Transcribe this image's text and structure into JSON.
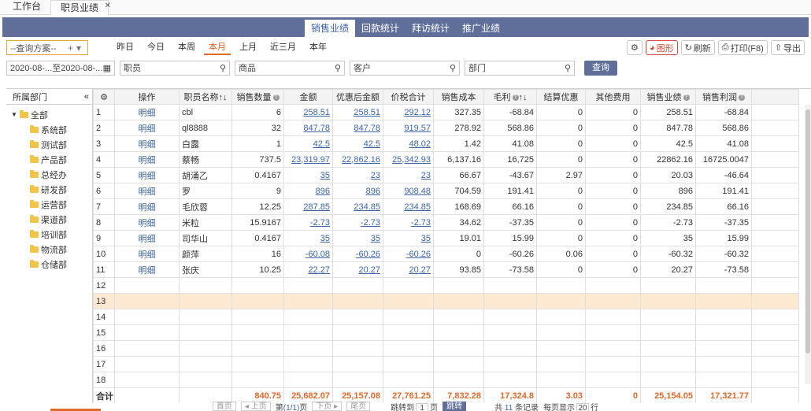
{
  "tabs": [
    {
      "label": "工作台",
      "active": false
    },
    {
      "label": "职员业绩",
      "active": true
    }
  ],
  "header_tabs": [
    {
      "label": "销售业绩",
      "active": true
    },
    {
      "label": "回款统计",
      "active": false
    },
    {
      "label": "拜访统计",
      "active": false
    },
    {
      "label": "推广业绩",
      "active": false
    }
  ],
  "toolbar": {
    "scheme": "--查询方案--",
    "dates": [
      {
        "label": "昨日"
      },
      {
        "label": "今日"
      },
      {
        "label": "本周"
      },
      {
        "label": "本月",
        "active": true
      },
      {
        "label": "上月"
      },
      {
        "label": "近三月"
      },
      {
        "label": "本年"
      }
    ],
    "buttons": {
      "chart": "图形",
      "refresh": "刷新",
      "print": "打印(F8)",
      "export": "导出"
    }
  },
  "filters": {
    "date_range": "2020-08-...至2020-08-...",
    "employee": "职员",
    "product": "商品",
    "customer": "客户",
    "department": "部门",
    "query": "查询"
  },
  "sidebar": {
    "title": "所属部门",
    "root": "全部",
    "items": [
      "系统部",
      "测试部",
      "产品部",
      "总经办",
      "研发部",
      "运营部",
      "渠道部",
      "培训部",
      "物流部",
      "仓储部"
    ]
  },
  "columns": [
    "操作",
    "职员名称",
    "销售数量",
    "金额",
    "优惠后金额",
    "价税合计",
    "销售成本",
    "毛利",
    "结算优惠",
    "其他费用",
    "销售业绩",
    "销售利润"
  ],
  "rows": [
    {
      "n": "1",
      "op": "明细",
      "name": "cbl",
      "qty": "6",
      "amt": "258.51",
      "disc": "258.51",
      "tax": "292.12",
      "cost": "327.35",
      "gross": "-68.84",
      "settle": "0",
      "other": "0",
      "perf": "258.51",
      "profit": "-68.84"
    },
    {
      "n": "2",
      "op": "明细",
      "name": "ql8888",
      "qty": "32",
      "amt": "847.78",
      "disc": "847.78",
      "tax": "919.57",
      "cost": "278.92",
      "gross": "568.86",
      "settle": "0",
      "other": "0",
      "perf": "847.78",
      "profit": "568.86"
    },
    {
      "n": "3",
      "op": "明细",
      "name": "白露",
      "qty": "1",
      "amt": "42.5",
      "disc": "42.5",
      "tax": "48.02",
      "cost": "1.42",
      "gross": "41.08",
      "settle": "0",
      "other": "0",
      "perf": "42.5",
      "profit": "41.08"
    },
    {
      "n": "4",
      "op": "明细",
      "name": "蔡畅",
      "qty": "737.5",
      "amt": "23,319.97",
      "disc": "22,862.16",
      "tax": "25,342.93",
      "cost": "6,137.16",
      "gross": "16,725",
      "settle": "0",
      "other": "0",
      "perf": "22862.16",
      "profit": "16725.0047"
    },
    {
      "n": "5",
      "op": "明细",
      "name": "胡涌乙",
      "qty": "0.4167",
      "amt": "35",
      "disc": "23",
      "tax": "23",
      "cost": "66.67",
      "gross": "-43.67",
      "settle": "2.97",
      "other": "0",
      "perf": "20.03",
      "profit": "-46.64"
    },
    {
      "n": "6",
      "op": "明细",
      "name": "罗",
      "qty": "9",
      "amt": "896",
      "disc": "896",
      "tax": "908.48",
      "cost": "704.59",
      "gross": "191.41",
      "settle": "0",
      "other": "0",
      "perf": "896",
      "profit": "191.41"
    },
    {
      "n": "7",
      "op": "明细",
      "name": "毛欣蓉",
      "qty": "12.25",
      "amt": "287.85",
      "disc": "234.85",
      "tax": "234.85",
      "cost": "168.69",
      "gross": "66.16",
      "settle": "0",
      "other": "0",
      "perf": "234.85",
      "profit": "66.16"
    },
    {
      "n": "8",
      "op": "明细",
      "name": "米粒",
      "qty": "15.9167",
      "amt": "-2.73",
      "disc": "-2.73",
      "tax": "-2.73",
      "cost": "34.62",
      "gross": "-37.35",
      "settle": "0",
      "other": "0",
      "perf": "-2.73",
      "profit": "-37.35"
    },
    {
      "n": "9",
      "op": "明细",
      "name": "司华山",
      "qty": "0.4167",
      "amt": "35",
      "disc": "35",
      "tax": "35",
      "cost": "19.01",
      "gross": "15.99",
      "settle": "0",
      "other": "0",
      "perf": "35",
      "profit": "15.99"
    },
    {
      "n": "10",
      "op": "明细",
      "name": "颜萍",
      "qty": "16",
      "amt": "-60.08",
      "disc": "-60.26",
      "tax": "-60.26",
      "cost": "0",
      "gross": "-60.26",
      "settle": "0.06",
      "other": "0",
      "perf": "-60.32",
      "profit": "-60.32"
    },
    {
      "n": "11",
      "op": "明细",
      "name": "张庆",
      "qty": "10.25",
      "amt": "22.27",
      "disc": "20.27",
      "tax": "20.27",
      "cost": "93.85",
      "gross": "-73.58",
      "settle": "0",
      "other": "0",
      "perf": "20.27",
      "profit": "-73.58"
    }
  ],
  "empty_rows": [
    "12",
    "13",
    "14",
    "15",
    "16",
    "17",
    "18"
  ],
  "totals": {
    "label": "合计",
    "qty": "840.75",
    "amt": "25,682.07",
    "disc": "25,157.08",
    "tax": "27,761.25",
    "cost": "7,832.28",
    "gross": "17,324.8",
    "settle": "3.03",
    "other": "0",
    "perf": "25,154.05",
    "profit": "17,321.77"
  },
  "pager": {
    "first": "首页",
    "prev": "上页",
    "page_prefix": "第",
    "page_info": "(1/1)",
    "page_suffix": "页",
    "next": "下页",
    "last": "尾页",
    "jump_prefix": "跳转到",
    "jump_value": "1",
    "jump_suffix": "页",
    "go": "跳转",
    "records_prefix": "共",
    "records": "11",
    "records_suffix": "条记录",
    "per_page_prefix": "每页显示",
    "per_page": "20",
    "per_page_suffix": "行"
  }
}
